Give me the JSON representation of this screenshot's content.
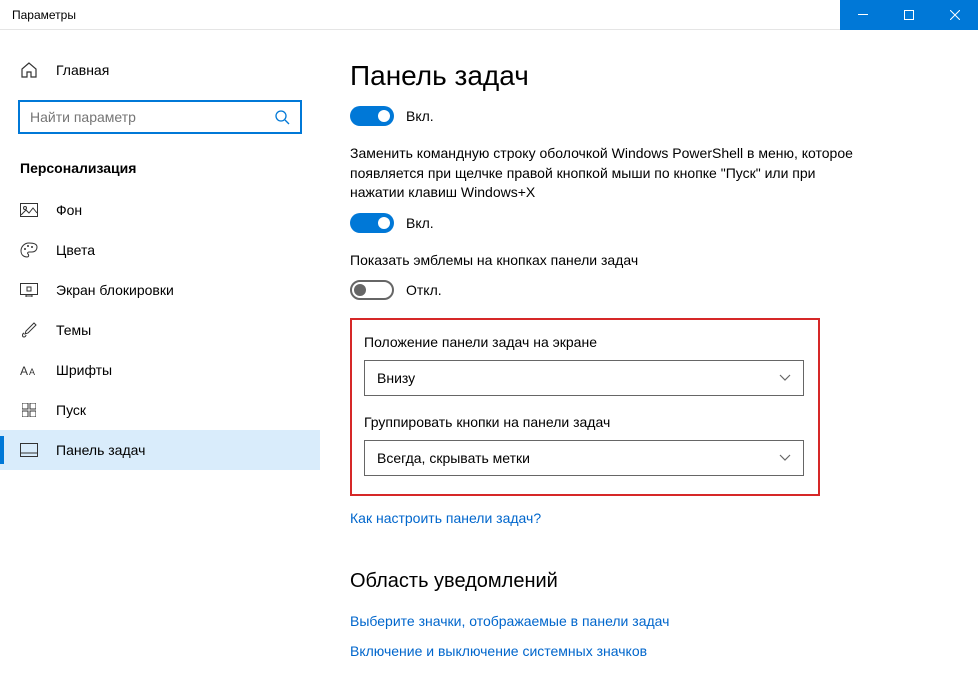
{
  "titlebar": {
    "title": "Параметры"
  },
  "sidebar": {
    "home": "Главная",
    "search_placeholder": "Найти параметр",
    "section": "Персонализация",
    "items": [
      {
        "label": "Фон",
        "icon": "image"
      },
      {
        "label": "Цвета",
        "icon": "palette"
      },
      {
        "label": "Экран блокировки",
        "icon": "lock-screen"
      },
      {
        "label": "Темы",
        "icon": "brush"
      },
      {
        "label": "Шрифты",
        "icon": "font"
      },
      {
        "label": "Пуск",
        "icon": "start"
      },
      {
        "label": "Панель задач",
        "icon": "taskbar"
      }
    ]
  },
  "main": {
    "title": "Панель задач",
    "toggles": {
      "t1_state": "Вкл.",
      "t2_desc": "Заменить командную строку оболочкой Windows PowerShell в меню, которое появляется при щелчке правой кнопкой мыши по кнопке \"Пуск\" или при нажатии клавиш Windows+X",
      "t2_state": "Вкл.",
      "t3_desc": "Показать эмблемы на кнопках панели задач",
      "t3_state": "Откл."
    },
    "position": {
      "label": "Положение панели задач на экране",
      "value": "Внизу"
    },
    "grouping": {
      "label": "Группировать кнопки на панели задач",
      "value": "Всегда, скрывать метки"
    },
    "help_link": "Как настроить панели задач?",
    "notification_section": "Область уведомлений",
    "link_icons": "Выберите значки, отображаемые в панели задач",
    "link_system_icons": "Включение и выключение системных значков"
  }
}
